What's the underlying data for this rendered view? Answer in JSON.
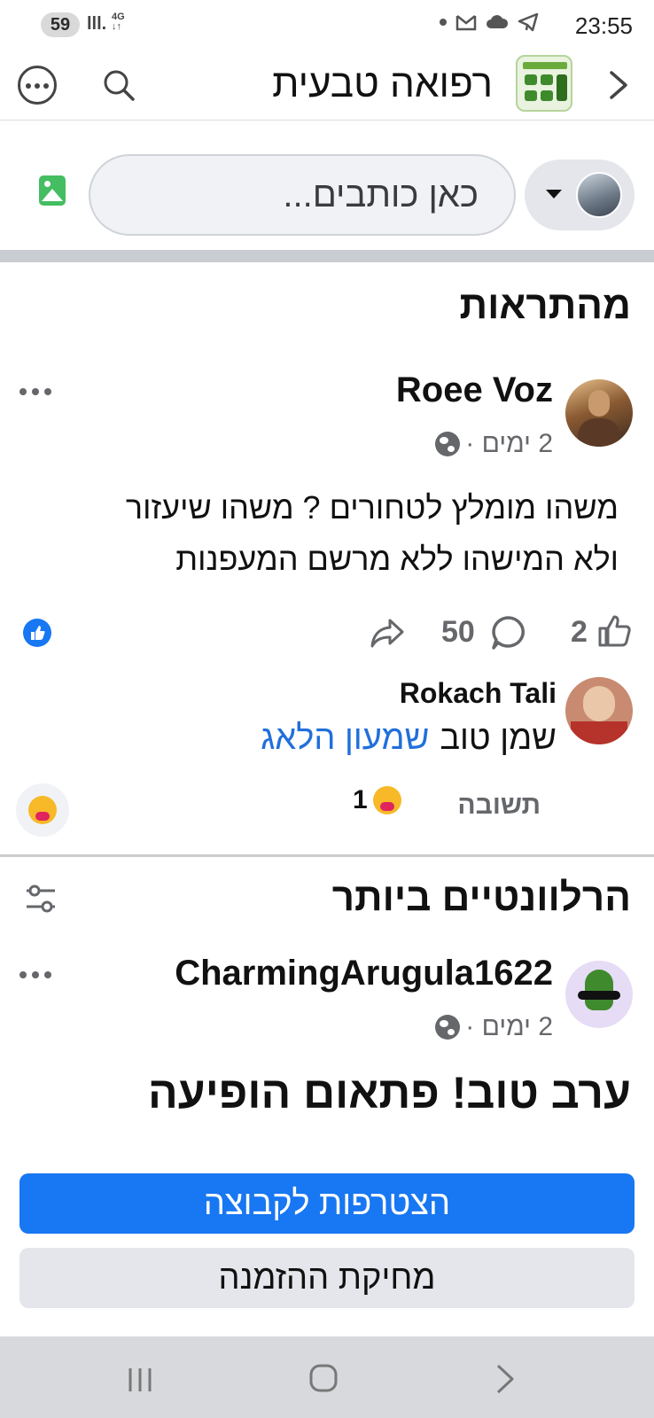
{
  "status_bar": {
    "badge": "59",
    "signal": "lll.",
    "network": "4G",
    "time": "23:55",
    "icons": [
      "dot-icon",
      "gmail-icon",
      "cloud-icon",
      "telegram-icon"
    ]
  },
  "header": {
    "title": "רפואה טבעית",
    "icons": {
      "more": "more-options-icon",
      "search": "search-icon",
      "back": "chevron-right-icon"
    }
  },
  "composer": {
    "placeholder": "כאן כותבים..."
  },
  "highlights": {
    "section_title": "מהתראות",
    "post": {
      "author": "Roee Voz",
      "time": "2 ימים · ",
      "text_line1": "משהו מומלץ לטחורים ? משהו שיעזור",
      "text_line2": "ולא המישהו ללא מרשם המעפנות",
      "like_count": "2",
      "comment_count": "50"
    },
    "comment": {
      "author": "Rokach Tali",
      "text": "שמן טוב",
      "mention": "שמעון הלאג",
      "reply_label": "תשובה",
      "reaction_count": "1"
    }
  },
  "relevant": {
    "section_title": "הרלוונטיים ביותר",
    "post": {
      "author": "CharmingArugula1622",
      "time": "2 ימים · ",
      "text": "ערב טוב! פתאום הופיעה"
    }
  },
  "actions": {
    "join_label": "הצטרפות לקבוצה",
    "delete_invite_label": "מחיקת ההזמנה"
  },
  "colors": {
    "accent": "#1877f2",
    "mention": "#216fdb",
    "muted": "#65676b"
  }
}
